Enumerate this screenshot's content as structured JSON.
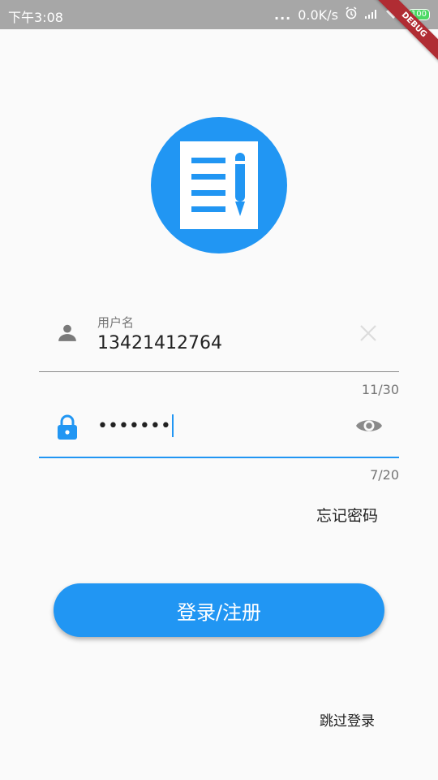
{
  "status_bar": {
    "time": "下午3:08",
    "dots": "...",
    "speed": "0.0K/s",
    "battery": "100"
  },
  "debug_banner": "DEBUG",
  "logo": {
    "icon": "note-edit-icon",
    "bg_color": "#2196f3"
  },
  "username_field": {
    "label": "用户名",
    "value": "13421412764",
    "counter": "11/30",
    "prefix_icon": "person-icon",
    "suffix_icon": "close-icon"
  },
  "password_field": {
    "value": "•••••••",
    "counter": "7/20",
    "prefix_icon": "lock-icon",
    "suffix_icon": "eye-icon"
  },
  "forgot_password": "忘记密码",
  "login_button": "登录/注册",
  "skip_login": "跳过登录",
  "colors": {
    "accent": "#2196f3",
    "status_bar": "#a7a7a7",
    "background": "#fafafa"
  }
}
